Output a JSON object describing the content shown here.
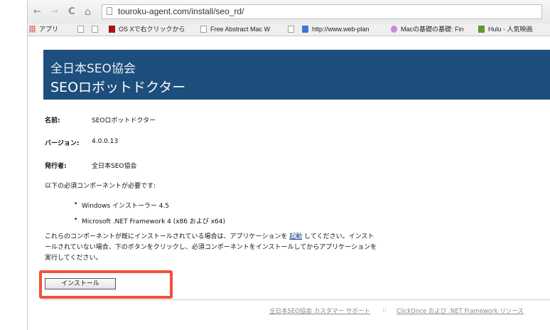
{
  "browser": {
    "url": "touroku-agent.com/install/seo_rd/",
    "nav": {
      "back": "←",
      "forward": "→",
      "reload": "C",
      "home": "⌂"
    },
    "bookmarks": [
      {
        "label": "アプリ",
        "icon": "apps-icon"
      },
      {
        "label": "",
        "icon": "page-icon"
      },
      {
        "label": "",
        "icon": "page-icon"
      },
      {
        "label": "OS Xで右クリックから",
        "icon": "red-icon"
      },
      {
        "label": "Free Abstract Mac W",
        "icon": "page-icon"
      },
      {
        "label": "",
        "icon": "page-icon"
      },
      {
        "label": "http://www.web-plan",
        "icon": "google-icon"
      },
      {
        "label": "Macの基礎の基礎: Fin",
        "icon": "mac-icon"
      },
      {
        "label": "Hulu - 人気映画",
        "icon": "hulu-icon"
      }
    ]
  },
  "header": {
    "org": "全日本SEO協会",
    "title": "SEOロボットドクター"
  },
  "info": {
    "name_label": "名前:",
    "name_value": "SEOロボットドクター",
    "version_label": "バージョン:",
    "version_value": "4.0.0.13",
    "publisher_label": "発行者:",
    "publisher_value": "全日本SEO協会"
  },
  "requirements": {
    "intro": "以下の必須コンポーネントが必要です:",
    "items": [
      "Windows インストーラー 4.5",
      "Microsoft .NET Framework 4 (x86 および x64)"
    ]
  },
  "description": {
    "before_link": "これらのコンポーネントが既にインストールされている場合は、アプリケーションを ",
    "link": "起動",
    "after_link": " してください。インストールされていない場合、下のボタンをクリックし、必須コンポーネントをインストールしてからアプリケーションを実行してください。"
  },
  "install_button": "インストール",
  "footer": {
    "support_link": "全日本SEO協会 カスタマー サポート",
    "separator": "::",
    "resources_link": "ClickOnce および .NET Framework リソース"
  },
  "colors": {
    "header_bg": "#1d4e7d",
    "highlight": "#f2513a",
    "link": "#1d3f8c"
  }
}
